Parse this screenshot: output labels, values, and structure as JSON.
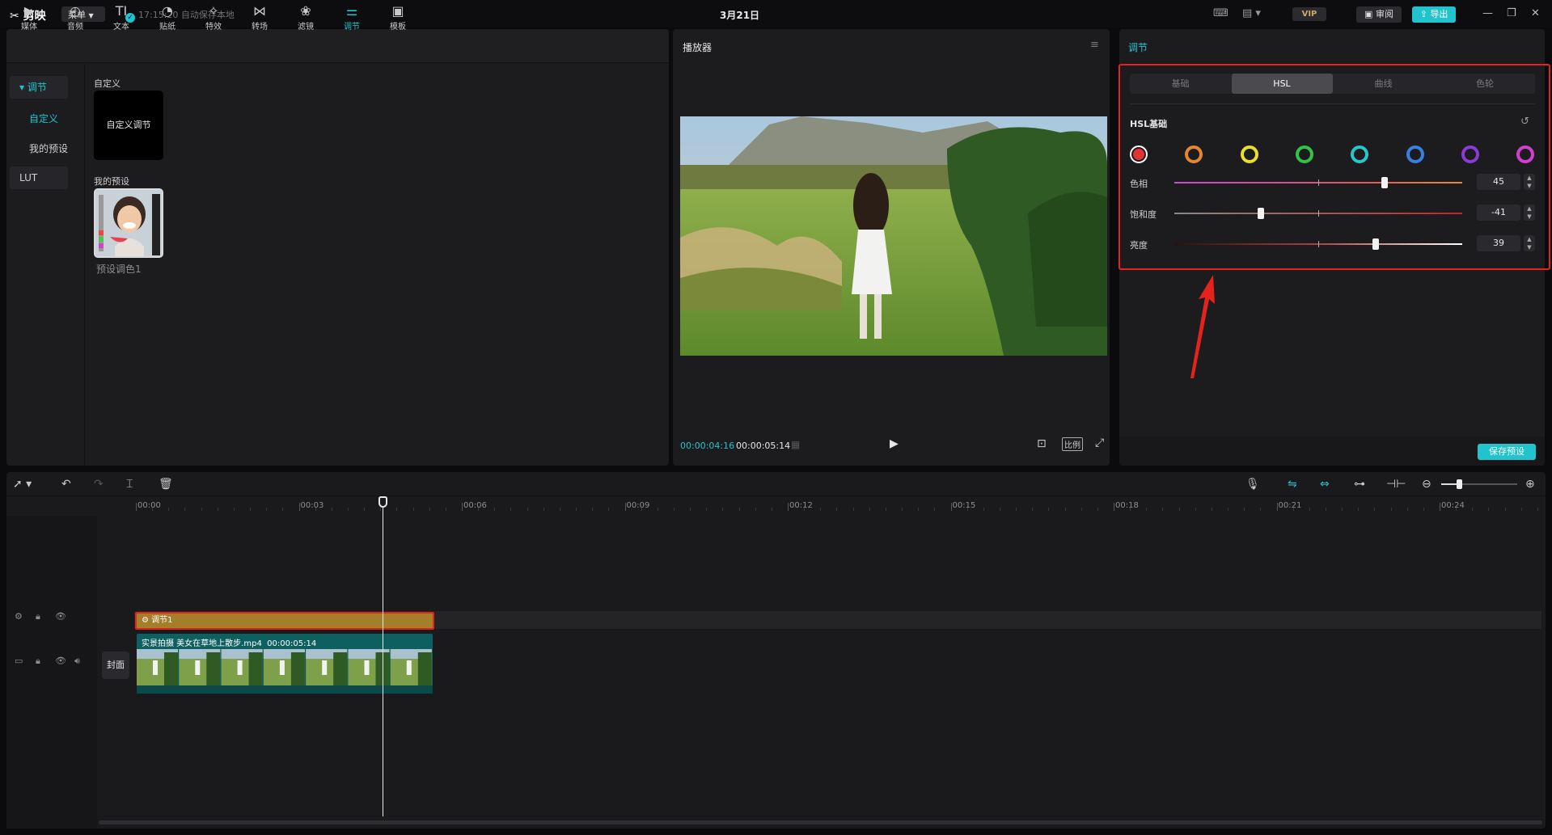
{
  "app": {
    "logo": "剪映",
    "menu": "菜单",
    "save_status": "17:15:20 自动保存本地",
    "title": "3月21日",
    "vip": "VIP",
    "review": "审阅",
    "export": "导出"
  },
  "toolbar": [
    {
      "label": "媒体",
      "icon": "media-icon"
    },
    {
      "label": "音频",
      "icon": "audio-icon"
    },
    {
      "label": "文本",
      "icon": "text-icon"
    },
    {
      "label": "贴纸",
      "icon": "sticker-icon"
    },
    {
      "label": "特效",
      "icon": "effects-icon"
    },
    {
      "label": "转场",
      "icon": "transition-icon"
    },
    {
      "label": "滤镜",
      "icon": "filter-icon"
    },
    {
      "label": "调节",
      "icon": "adjust-icon",
      "active": true
    },
    {
      "label": "模板",
      "icon": "template-icon"
    }
  ],
  "left_nav": {
    "group": "调节",
    "custom": "自定义",
    "my_presets": "我的预设",
    "lut": "LUT"
  },
  "content": {
    "custom_section": "自定义",
    "custom_card": "自定义调节",
    "presets_section": "我的预设",
    "preset_name": "预设调色1"
  },
  "player": {
    "title": "播放器",
    "current_time": "00:00:04:16",
    "total_time": "00:00:05:14",
    "ratio": "比例"
  },
  "adjust": {
    "title": "调节",
    "tabs": [
      "基础",
      "HSL",
      "曲线",
      "色轮"
    ],
    "selected_tab": "HSL",
    "section": "HSL基础",
    "colors": [
      "#e03434",
      "#e3862f",
      "#e8e12a",
      "#31c24a",
      "#26c7c9",
      "#3a7fe0",
      "#8a3ad8",
      "#d23fd0"
    ],
    "sliders": [
      {
        "label": "色相",
        "value": "45",
        "fraction": 0.73
      },
      {
        "label": "饱和度",
        "value": "-41",
        "fraction": 0.3
      },
      {
        "label": "亮度",
        "value": "39",
        "fraction": 0.7
      }
    ],
    "save_preset": "保存预设"
  },
  "timeline": {
    "ruler": [
      "00:00",
      "00:03",
      "00:06",
      "00:09",
      "00:12",
      "00:15",
      "00:18",
      "00:21",
      "00:24"
    ],
    "adj_clip": "调节1",
    "video_clip_name": "实景拍摄 美女在草地上散步.mp4",
    "video_clip_duration": "00:00:05:14",
    "cover": "封面"
  }
}
